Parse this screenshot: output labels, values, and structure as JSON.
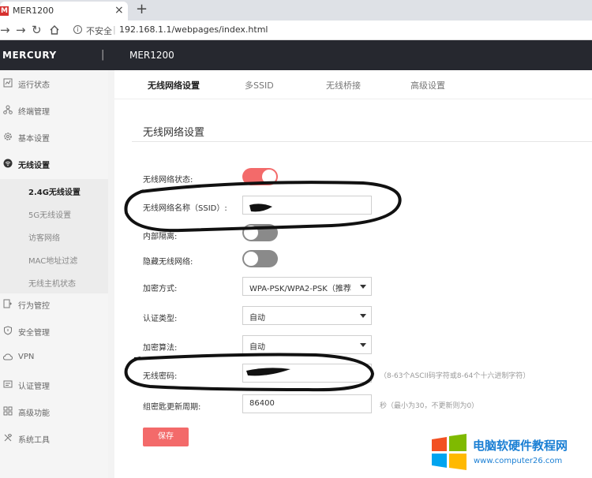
{
  "browser": {
    "tab_title": "MER1200",
    "favicon_text": "M",
    "tab_close": "×",
    "new_tab": "+",
    "insecure_label": "不安全",
    "url": "192.168.1.1/webpages/index.html"
  },
  "header": {
    "brand": "MERCURY",
    "separator": "|",
    "model": "MER1200"
  },
  "sidebar": {
    "items": [
      {
        "label": "运行状态",
        "icon": "status-icon"
      },
      {
        "label": "终端管理",
        "icon": "devices-icon"
      },
      {
        "label": "基本设置",
        "icon": "gear-icon"
      },
      {
        "label": "无线设置",
        "icon": "wifi-icon"
      },
      {
        "label": "行为管控",
        "icon": "behavior-icon"
      },
      {
        "label": "安全管理",
        "icon": "shield-icon"
      },
      {
        "label": "VPN",
        "icon": "vpn-icon"
      },
      {
        "label": "认证管理",
        "icon": "auth-icon"
      },
      {
        "label": "高级功能",
        "icon": "advanced-icon"
      },
      {
        "label": "系统工具",
        "icon": "tools-icon"
      }
    ],
    "wireless_subitems": [
      "2.4G无线设置",
      "5G无线设置",
      "访客网络",
      "MAC地址过滤",
      "无线主机状态"
    ]
  },
  "main": {
    "tabs": [
      "无线网络设置",
      "多SSID",
      "无线桥接",
      "高级设置"
    ],
    "section_title": "无线网络设置",
    "fields": {
      "wifi_status_label": "无线网络状态:",
      "wifi_status_on": true,
      "ssid_label": "无线网络名称（SSID）:",
      "isolation_label": "内部隔离:",
      "isolation_on": false,
      "hide_label": "隐藏无线网络:",
      "hide_on": false,
      "encryption_label": "加密方式:",
      "encryption_value": "WPA-PSK/WPA2-PSK（推荐",
      "auth_label": "认证类型:",
      "auth_value": "自动",
      "algorithm_label": "加密算法:",
      "algorithm_value": "自动",
      "password_label": "无线密码:",
      "password_hint": "（8-63个ASCII码字符或8-64个十六进制字符）",
      "rekey_label": "组密匙更新周期:",
      "rekey_value": "86400",
      "rekey_hint": "秒（最小为30，不更新则为0）",
      "save_label": "保存"
    }
  },
  "watermark": {
    "title": "电脑软硬件教程网",
    "url": "www.computer26.com"
  },
  "colors": {
    "accent": "#f36a6a",
    "header_bg": "#26282f",
    "watermark_blue": "#1a7fd4"
  }
}
